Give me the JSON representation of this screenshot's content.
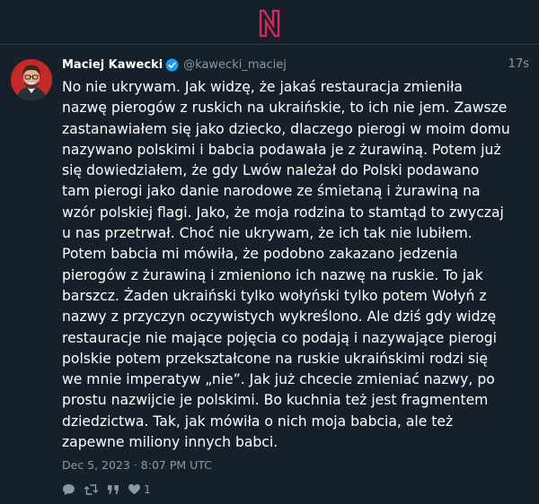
{
  "app": {
    "logo_icon": "stylized-n-logo-icon",
    "accent_color": "#e0245e",
    "background_color": "#15202b"
  },
  "tweet": {
    "author": {
      "display_name": "Maciej Kawecki",
      "handle": "@kawecki_maciej",
      "verified": true,
      "avatar_icon": "avatar"
    },
    "time_ago": "17s",
    "text": "No nie ukrywam. Jak widzę, że jakaś restauracja zmieniła nazwę pierogów z ruskich na ukraińskie, to ich nie jem. Zawsze zastanawiałem się jako dziecko, dlaczego pierogi w moim domu nazywano polskimi i babcia podawała je z żurawiną. Potem już się dowiedziałem, że gdy Lwów należał do Polski podawano tam pierogi jako danie narodowe ze śmietaną i żurawiną na wzór polskiej flagi. Jako, że moja rodzina to stamtąd to zwyczaj u nas przetrwał. Choć nie ukrywam, że ich tak nie lubiłem. Potem babcia mi mówiła, że podobno zakazano jedzenia pierogów z żurawiną i zmieniono ich nazwę na ruskie. To jak barszcz. Żaden ukraiński tylko wołyński tylko potem Wołyń z nazwy z przyczyn oczywistych wykreślono. Ale dziś gdy widzę restauracje nie mające pojęcia co podają i nazywające pierogi polskie potem przekształcone na ruskie ukraińskimi rodzi się we mnie imperatyw „nie”. Jak już chcecie zmieniać nazwy, po prostu nazwijcie je polskimi. Bo kuchnia też jest fragmentem dziedzictwa. Tak, jak mówiła o nich moja babcia, ale też zapewne miliony innych babci.",
    "timestamp": "Dec 5, 2023 · 8:07 PM UTC",
    "actions": {
      "reply_icon": "reply-icon",
      "retweet_icon": "retweet-icon",
      "quote_icon": "quote-icon",
      "like_icon": "heart-icon",
      "like_count": "1"
    }
  }
}
